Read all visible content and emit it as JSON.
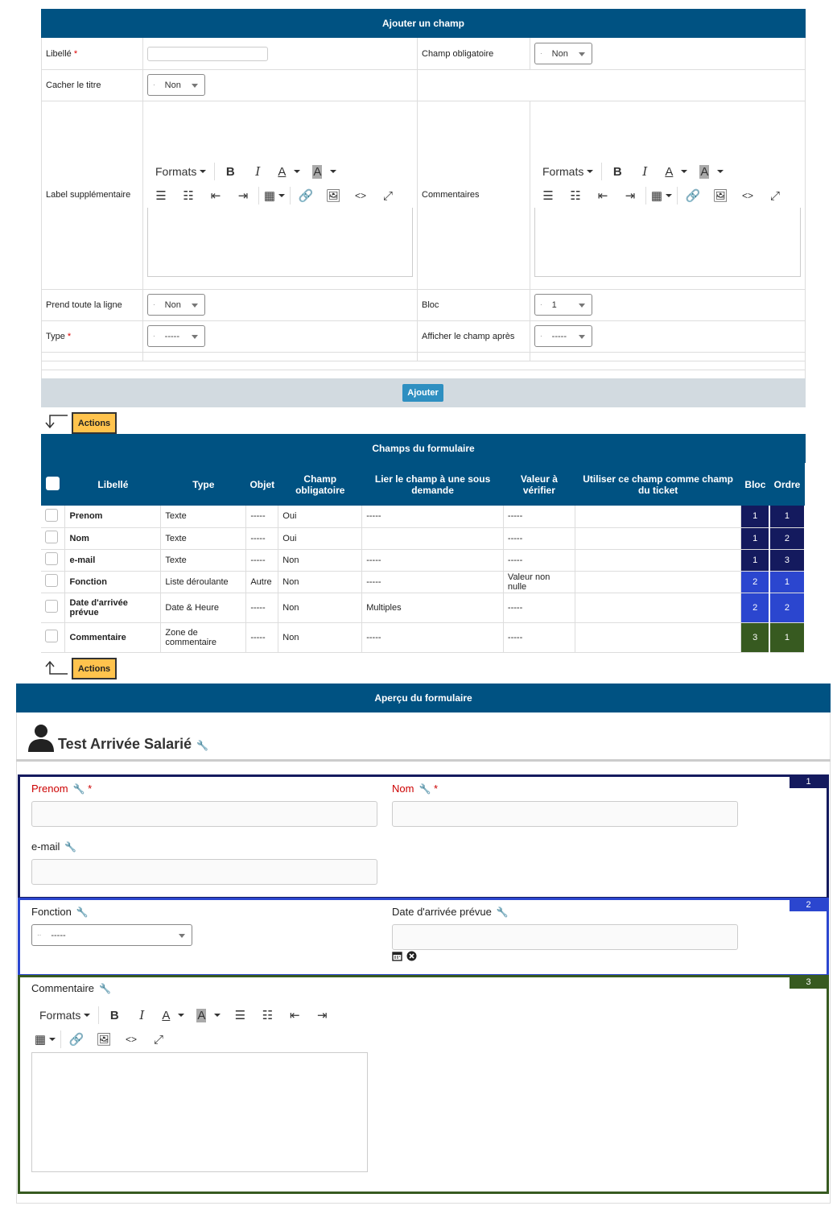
{
  "add_field": {
    "title": "Ajouter un champ",
    "libelle_label": "Libellé",
    "required_mark": "*",
    "champ_obligatoire_label": "Champ obligatoire",
    "champ_obligatoire_value": "Non",
    "cacher_titre_label": "Cacher le titre",
    "cacher_titre_value": "Non",
    "label_supp_label": "Label supplémentaire",
    "commentaires_label": "Commentaires",
    "prend_ligne_label": "Prend toute la ligne",
    "prend_ligne_value": "Non",
    "bloc_label": "Bloc",
    "bloc_value": "1",
    "type_label": "Type",
    "type_value": "-----",
    "afficher_apres_label": "Afficher le champ après",
    "afficher_apres_value": "-----",
    "add_button": "Ajouter"
  },
  "editor": {
    "formats_label": "Formats",
    "bold": "B",
    "italic": "I",
    "font_color": "A",
    "bg_color": "A",
    "source": "<>"
  },
  "actions_label": "Actions",
  "fields_table": {
    "title": "Champs du formulaire",
    "headers": [
      "Libellé",
      "Type",
      "Objet",
      "Champ obligatoire",
      "Lier le champ à une sous demande",
      "Valeur à vérifier",
      "Utiliser ce champ comme champ du ticket",
      "Bloc",
      "Ordre"
    ],
    "rows": [
      {
        "libelle": "Prenom",
        "type": "Texte",
        "objet": "-----",
        "obligatoire": "Oui",
        "lier": "-----",
        "valeur": "-----",
        "utiliser": "",
        "bloc": "1",
        "ordre": "1"
      },
      {
        "libelle": "Nom",
        "type": "Texte",
        "objet": "-----",
        "obligatoire": "Oui",
        "lier": "",
        "valeur": "-----",
        "utiliser": "",
        "bloc": "1",
        "ordre": "2"
      },
      {
        "libelle": "e-mail",
        "type": "Texte",
        "objet": "-----",
        "obligatoire": "Non",
        "lier": "-----",
        "valeur": "-----",
        "utiliser": "",
        "bloc": "1",
        "ordre": "3"
      },
      {
        "libelle": "Fonction",
        "type": "Liste déroulante",
        "objet": "Autre",
        "obligatoire": "Non",
        "lier": "-----",
        "valeur": "Valeur non nulle",
        "utiliser": "",
        "bloc": "2",
        "ordre": "1"
      },
      {
        "libelle": "Date d'arrivée prévue",
        "type": "Date & Heure",
        "objet": "-----",
        "obligatoire": "Non",
        "lier": "Multiples",
        "valeur": "-----",
        "utiliser": "",
        "bloc": "2",
        "ordre": "2"
      },
      {
        "libelle": "Commentaire",
        "type": "Zone de commentaire",
        "objet": "-----",
        "obligatoire": "Non",
        "lier": "-----",
        "valeur": "-----",
        "utiliser": "",
        "bloc": "3",
        "ordre": "1"
      }
    ]
  },
  "preview": {
    "title": "Aperçu du formulaire",
    "form_title": "Test Arrivée Salarié",
    "bloc1_tag": "1",
    "bloc2_tag": "2",
    "bloc3_tag": "3",
    "prenom_label": "Prenom",
    "nom_label": "Nom",
    "email_label": "e-mail",
    "fonction_label": "Fonction",
    "fonction_value": "-----",
    "date_label": "Date d'arrivée prévue",
    "commentaire_label": "Commentaire"
  },
  "colors": {
    "header": "#005282",
    "bloc1": "#141a5e",
    "bloc2": "#2b46cf",
    "bloc3": "#375a20",
    "actions": "#ffc34d",
    "required": "#c00"
  }
}
